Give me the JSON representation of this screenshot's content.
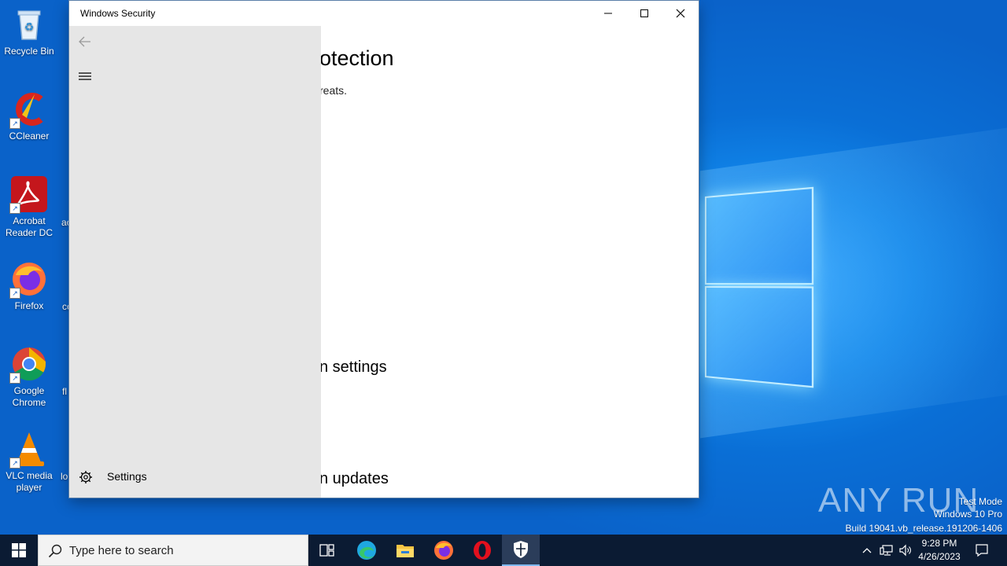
{
  "window": {
    "title": "Windows Security",
    "minimize_icon": "minimize-icon",
    "maximize_icon": "maximize-icon",
    "close_icon": "close-icon"
  },
  "content": {
    "heading": "otection",
    "subtitle": "reats.",
    "section_settings": "n settings",
    "section_updates": "n updates"
  },
  "nav": {
    "back_icon": "back-arrow-icon",
    "menu_icon": "hamburger-menu-icon",
    "settings_label": "Settings",
    "settings_icon": "gear-icon"
  },
  "desktop_icons": [
    {
      "label": "Recycle Bin",
      "icon": "recycle-bin-icon"
    },
    {
      "label": "CCleaner",
      "icon": "ccleaner-icon"
    },
    {
      "label": "Acrobat Reader DC",
      "icon": "acrobat-icon"
    },
    {
      "label": "Firefox",
      "icon": "firefox-icon"
    },
    {
      "label": "Google Chrome",
      "icon": "chrome-icon"
    },
    {
      "label": "VLC media player",
      "icon": "vlc-icon"
    }
  ],
  "desktop_partial_labels": [
    "ac",
    "cc",
    "fl",
    "lo"
  ],
  "watermark": {
    "brand": "ANY RUN",
    "line1": "Test Mode",
    "line2": "Windows 10 Pro",
    "line3": "Build 19041.vb_release.191206-1406"
  },
  "taskbar": {
    "search_placeholder": "Type here to search",
    "pinned": [
      "task-view-icon",
      "edge-icon",
      "file-explorer-icon",
      "firefox-icon",
      "opera-icon",
      "windows-security-icon"
    ],
    "time": "9:28 PM",
    "date": "4/26/2023"
  }
}
